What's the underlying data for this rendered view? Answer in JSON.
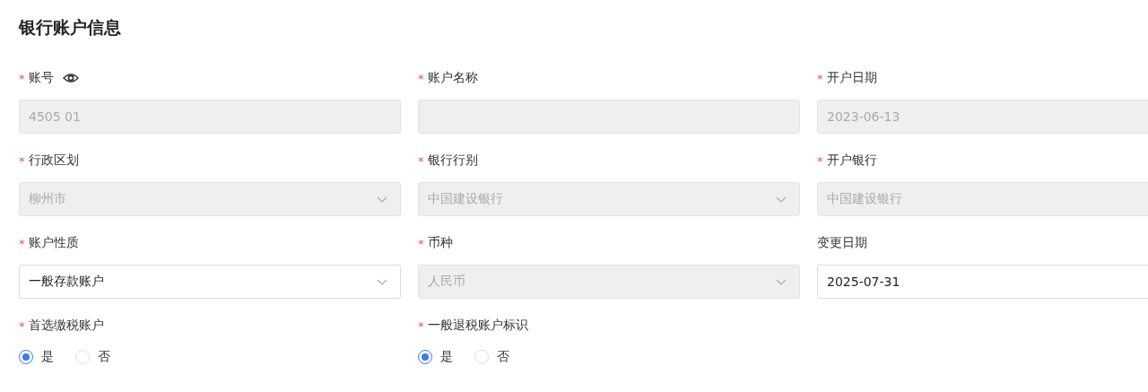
{
  "section": {
    "title": "银行账户信息"
  },
  "fields": [
    {
      "label": "账号",
      "required_mark": "*",
      "kind": "input",
      "value": "4505 01",
      "disabled": true,
      "eye_icon": true
    },
    {
      "label": "账户名称",
      "required_mark": "*",
      "kind": "input",
      "disabled": true
    },
    {
      "label": "开户日期",
      "required_mark": "*",
      "kind": "input",
      "value": "2023-06-13",
      "disabled": true
    },
    {
      "label": "行政区划",
      "required_mark": "*",
      "kind": "select",
      "value": "柳州市",
      "disabled": true
    },
    {
      "label": "银行行别",
      "required_mark": "*",
      "kind": "select",
      "value": "中国建设银行",
      "disabled": true
    },
    {
      "label": "开户银行",
      "required_mark": "*",
      "kind": "input",
      "value": "中国建设银行",
      "disabled": true
    },
    {
      "label": "账户性质",
      "required_mark": "*",
      "kind": "select",
      "value": "一般存款账户",
      "disabled": false
    },
    {
      "label": "币种",
      "required_mark": "*",
      "kind": "select",
      "value": "人民币",
      "disabled": true
    },
    {
      "label": "变更日期",
      "kind": "input",
      "value": "2025-07-31",
      "disabled": false
    },
    {
      "label": "首选缴税账户",
      "required_mark": "*",
      "kind": "radio",
      "options": [
        {
          "label": "是",
          "selected": true
        },
        {
          "label": "否",
          "selected": false
        }
      ]
    },
    {
      "label": "一般退税账户标识",
      "required_mark": "*",
      "kind": "radio",
      "options": [
        {
          "label": "是",
          "selected": true
        },
        {
          "label": "否",
          "selected": false
        }
      ]
    }
  ]
}
